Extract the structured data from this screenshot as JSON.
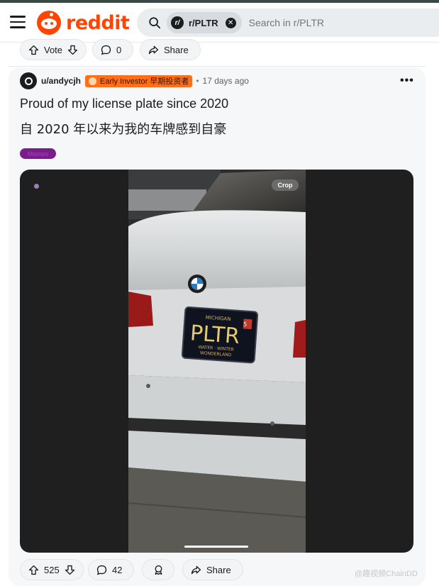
{
  "header": {
    "brand": "reddit",
    "search": {
      "chip_icon": "r/",
      "chip_label": "r/PLTR",
      "placeholder": "Search in r/PLTR"
    }
  },
  "prev_post_actions": {
    "vote_label": "Vote",
    "comments": "0",
    "share_label": "Share"
  },
  "post": {
    "username": "u/andycjh",
    "flair": "Early Investor  早期投资者",
    "time": "17 days ago",
    "title_en": "Proud of my license plate since 2020",
    "title_zh": "自 2020 年以来为我的车牌感到自豪",
    "post_flair": "Memes",
    "media": {
      "crop_label": "Crop",
      "plate": {
        "state": "MICHIGAN",
        "number": "PLTR",
        "slogan_line1": "WATER · WINTER",
        "slogan_line2": "WONDERLAND"
      },
      "badge": "5"
    },
    "actions": {
      "votes": "525",
      "comments": "42",
      "share_label": "Share"
    }
  },
  "watermark": "@趣视频ChainDD",
  "colors": {
    "brand": "#ff4500",
    "flair_bg": "#ff6f1a",
    "post_flair_bg": "#7c1a8e"
  }
}
